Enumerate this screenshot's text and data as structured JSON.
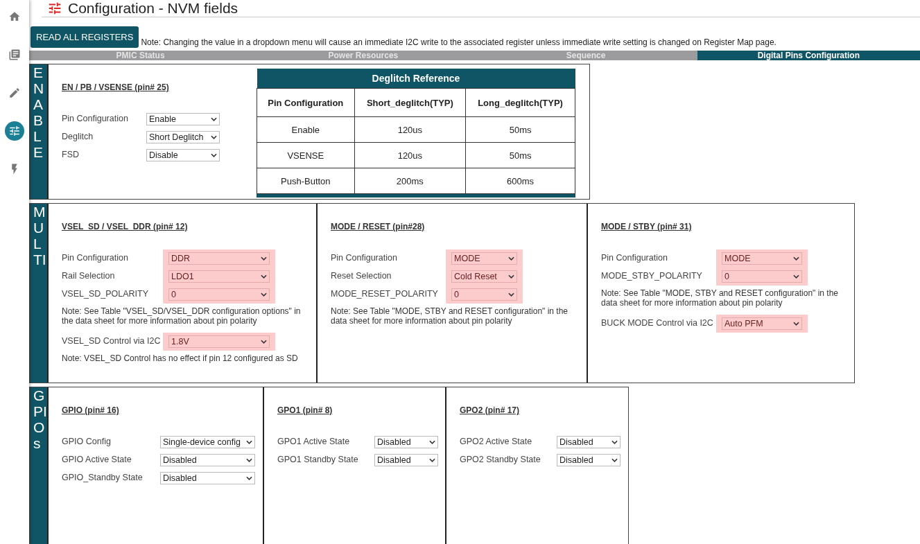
{
  "sidebar": {
    "items": [
      {
        "kind": "home",
        "selected": false
      },
      {
        "kind": "books",
        "selected": false
      },
      {
        "kind": "pencil",
        "selected": false
      },
      {
        "kind": "sliders",
        "selected": true
      },
      {
        "kind": "bolt",
        "selected": false
      }
    ]
  },
  "header": {
    "title": "Configuration - NVM fields"
  },
  "read_button": "READ ALL REGISTERS",
  "note": "Note: Changing the value in a dropdown menu will cause an immediate I2C write to the associated register unless immediate write setting is changed on Register Map page.",
  "tabs": [
    {
      "label": "PMIC Status",
      "selected": false
    },
    {
      "label": "Power Resources",
      "selected": false
    },
    {
      "label": "Sequence",
      "selected": false
    },
    {
      "label": "Digital Pins Configuration",
      "selected": true
    }
  ],
  "sections": [
    {
      "kind": "enable",
      "label": "ENABLE",
      "panels": [
        {
          "title": "EN / PB / VSENSE (pin# 25)",
          "items": [
            {
              "kind": "field",
              "label": "Pin Configuration",
              "value": "Enable",
              "highlighted": false
            },
            {
              "kind": "field",
              "label": "Deglitch",
              "value": "Short Deglitch",
              "highlighted": false
            },
            {
              "kind": "field",
              "label": "FSD",
              "value": "Disable",
              "highlighted": false
            }
          ]
        }
      ],
      "reference_table": {
        "title": "Deglitch Reference",
        "columns": [
          "Pin Configuration",
          "Short_deglitch(TYP)",
          "Long_deglitch(TYP)"
        ],
        "rows": [
          [
            "Enable",
            "120us",
            "50ms"
          ],
          [
            "VSENSE",
            "120us",
            "50ms"
          ],
          [
            "Push-Button",
            "200ms",
            "600ms"
          ]
        ]
      }
    },
    {
      "kind": "multi",
      "label": "MULTI",
      "panels": [
        {
          "title": "VSEL_SD / VSEL_DDR (pin# 12)",
          "items": [
            {
              "kind": "field",
              "label": "Pin Configuration",
              "value": "DDR",
              "highlighted": true
            },
            {
              "kind": "field",
              "label": "Rail Selection",
              "value": "LDO1",
              "highlighted": true
            },
            {
              "kind": "field",
              "label": "VSEL_SD_POLARITY",
              "value": "0",
              "highlighted": true
            },
            {
              "kind": "note",
              "text": "Note: See Table \"VSEL_SD/VSEL_DDR configuration options\" in the data sheet for more information about pin polarity"
            },
            {
              "kind": "field",
              "label": "VSEL_SD Control via I2C",
              "value": "1.8V",
              "highlighted": true
            },
            {
              "kind": "note",
              "text": "Note: VSEL_SD Control has no effect if pin 12 configured as SD"
            }
          ]
        },
        {
          "title": "MODE / RESET (pin#28)",
          "items": [
            {
              "kind": "field",
              "label": "Pin Configuration",
              "value": "MODE",
              "highlighted": true
            },
            {
              "kind": "field",
              "label": "Reset Selection",
              "value": "Cold Reset",
              "highlighted": true
            },
            {
              "kind": "field",
              "label": "MODE_RESET_POLARITY",
              "value": "0",
              "highlighted": true
            },
            {
              "kind": "note",
              "text": "Note: See Table \"MODE, STBY and RESET configuration\" in the data sheet for more information about pin polarity"
            }
          ]
        },
        {
          "title": "MODE / STBY (pin# 31)",
          "items": [
            {
              "kind": "field",
              "label": "Pin Configuration",
              "value": "MODE",
              "highlighted": true
            },
            {
              "kind": "field",
              "label": "MODE_STBY_POLARITY",
              "value": "0",
              "highlighted": true
            },
            {
              "kind": "note",
              "text": "Note: See Table \"MODE, STBY and RESET configuration\" in the data sheet for more information about pin polarity"
            },
            {
              "kind": "field",
              "label": "BUCK MODE Control via I2C",
              "value": "Auto PFM",
              "highlighted": true
            }
          ]
        }
      ]
    },
    {
      "kind": "gpio",
      "label": "GPIOs",
      "panels": [
        {
          "title": "GPIO (pin# 16)",
          "items": [
            {
              "kind": "field",
              "label": "GPIO Config",
              "value": "Single-device config",
              "highlighted": false
            },
            {
              "kind": "field",
              "label": "GPIO Active State",
              "value": "Disabled",
              "highlighted": false
            },
            {
              "kind": "field",
              "label": "GPIO_Standby State",
              "value": "Disabled",
              "highlighted": false
            }
          ]
        },
        {
          "title": "GPO1 (pin# 8)",
          "items": [
            {
              "kind": "field",
              "label": "GPO1 Active State",
              "value": "Disabled",
              "highlighted": false
            },
            {
              "kind": "field",
              "label": "GPO1 Standby State",
              "value": "Disabled",
              "highlighted": false
            }
          ]
        },
        {
          "title": "GPO2 (pin# 17)",
          "items": [
            {
              "kind": "field",
              "label": "GPO2 Active State",
              "value": "Disabled",
              "highlighted": false
            },
            {
              "kind": "field",
              "label": "GPO2 Standby State",
              "value": "Disabled",
              "highlighted": false
            }
          ]
        }
      ]
    }
  ]
}
